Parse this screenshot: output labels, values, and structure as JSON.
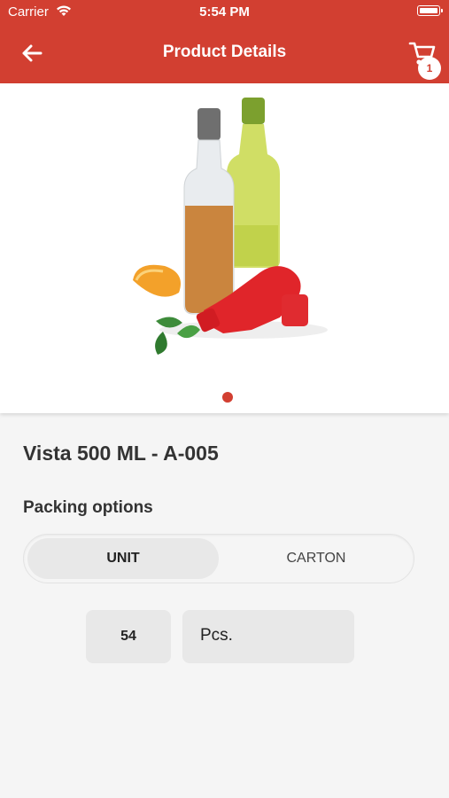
{
  "status_bar": {
    "carrier": "Carrier",
    "time": "5:54 PM"
  },
  "header": {
    "title": "Product Details",
    "cart_count": "1",
    "accent_color": "#d23f31"
  },
  "gallery": {
    "active_index": 1,
    "dots": 1
  },
  "product": {
    "name": "Vista 500 ML - A-005"
  },
  "packing": {
    "label": "Packing options",
    "options": [
      "UNIT",
      "CARTON"
    ],
    "selected": "UNIT"
  },
  "quantity": {
    "value": "54",
    "unit": "Pcs."
  }
}
